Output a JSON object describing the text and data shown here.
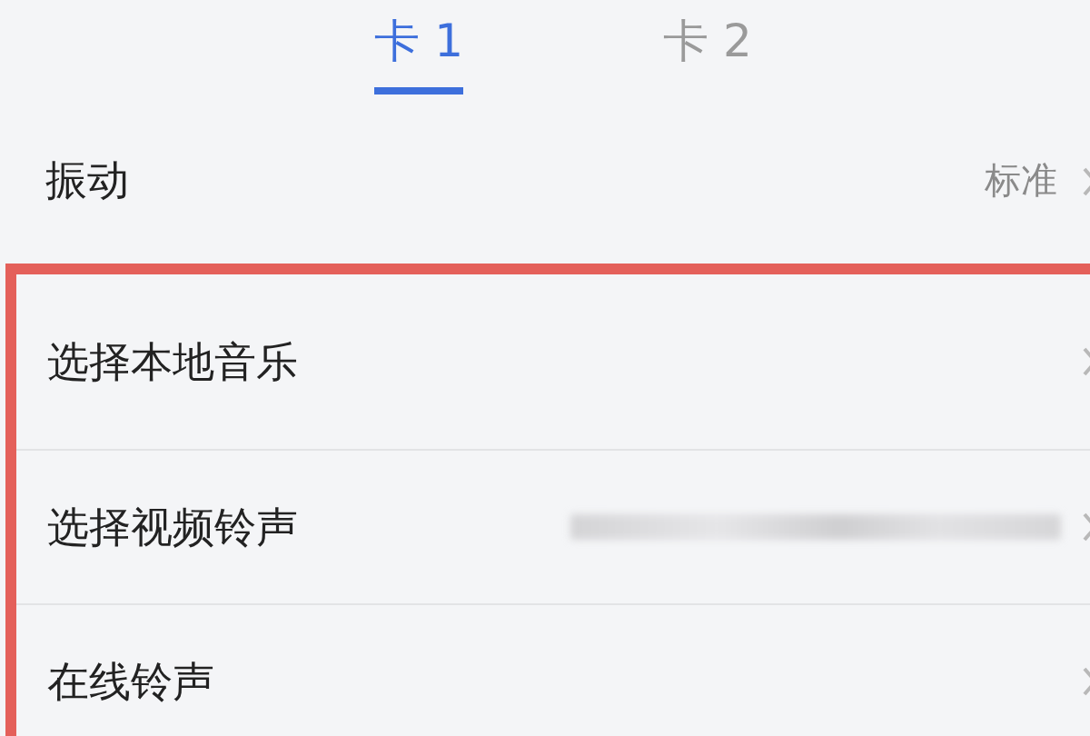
{
  "tabs": [
    {
      "label": "卡 1",
      "selected": true
    },
    {
      "label": "卡 2",
      "selected": false
    }
  ],
  "vibration": {
    "label": "振动",
    "value": "标准"
  },
  "highlighted_rows": [
    {
      "label": "选择本地音乐",
      "redacted": false
    },
    {
      "label": "选择视频铃声",
      "redacted": true
    },
    {
      "label": "在线铃声",
      "redacted": false
    }
  ]
}
